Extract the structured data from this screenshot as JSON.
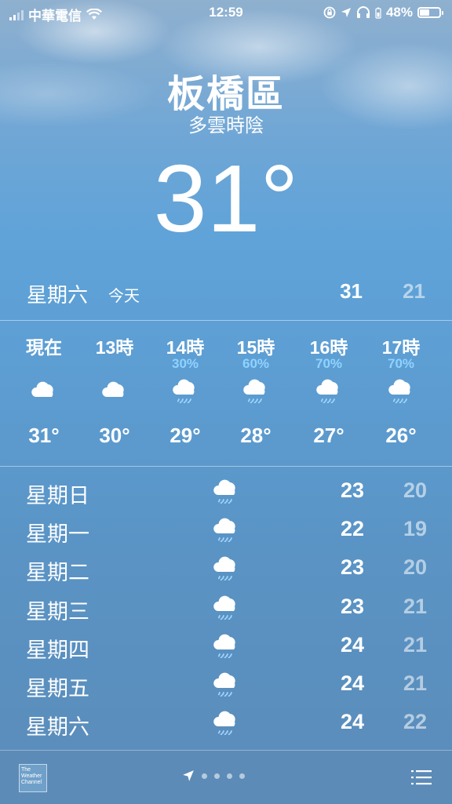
{
  "status_bar": {
    "carrier": "中華電信",
    "time": "12:59",
    "battery_percent": "48%",
    "battery_level": 0.48,
    "icons": [
      "signal-icon",
      "wifi-icon",
      "rotation-lock-icon",
      "location-arrow-icon",
      "headphones-icon",
      "battery-icon"
    ]
  },
  "location": {
    "city": "板橋區",
    "condition": "多雲時陰",
    "temperature": "31°"
  },
  "today": {
    "day": "星期六",
    "label": "今天",
    "high": "31",
    "low": "21"
  },
  "hourly": [
    {
      "time": "現在",
      "precip": "",
      "icon": "cloud-icon",
      "temp": "31°"
    },
    {
      "time": "13時",
      "precip": "",
      "icon": "cloud-icon",
      "temp": "30°"
    },
    {
      "time": "14時",
      "precip": "30%",
      "icon": "cloud-rain-icon",
      "temp": "29°"
    },
    {
      "time": "15時",
      "precip": "60%",
      "icon": "cloud-rain-icon",
      "temp": "28°"
    },
    {
      "time": "16時",
      "precip": "70%",
      "icon": "cloud-rain-icon",
      "temp": "27°"
    },
    {
      "time": "17時",
      "precip": "70%",
      "icon": "cloud-rain-icon",
      "temp": "26°"
    }
  ],
  "daily": [
    {
      "day": "星期日",
      "icon": "cloud-rain-icon",
      "high": "23",
      "low": "20"
    },
    {
      "day": "星期一",
      "icon": "cloud-rain-icon",
      "high": "22",
      "low": "19"
    },
    {
      "day": "星期二",
      "icon": "cloud-rain-icon",
      "high": "23",
      "low": "20"
    },
    {
      "day": "星期三",
      "icon": "cloud-rain-icon",
      "high": "23",
      "low": "21"
    },
    {
      "day": "星期四",
      "icon": "cloud-rain-icon",
      "high": "24",
      "low": "21"
    },
    {
      "day": "星期五",
      "icon": "cloud-rain-icon",
      "high": "24",
      "low": "21"
    },
    {
      "day": "星期六",
      "icon": "cloud-rain-icon",
      "high": "24",
      "low": "22"
    }
  ],
  "bottom_bar": {
    "logo_text": "The Weather Channel",
    "page_dots": 4,
    "icons": [
      "location-arrow-icon",
      "list-icon"
    ]
  },
  "colors": {
    "precip_text": "#8fd3ff",
    "low_temp": "rgba(255,255,255,0.55)"
  }
}
